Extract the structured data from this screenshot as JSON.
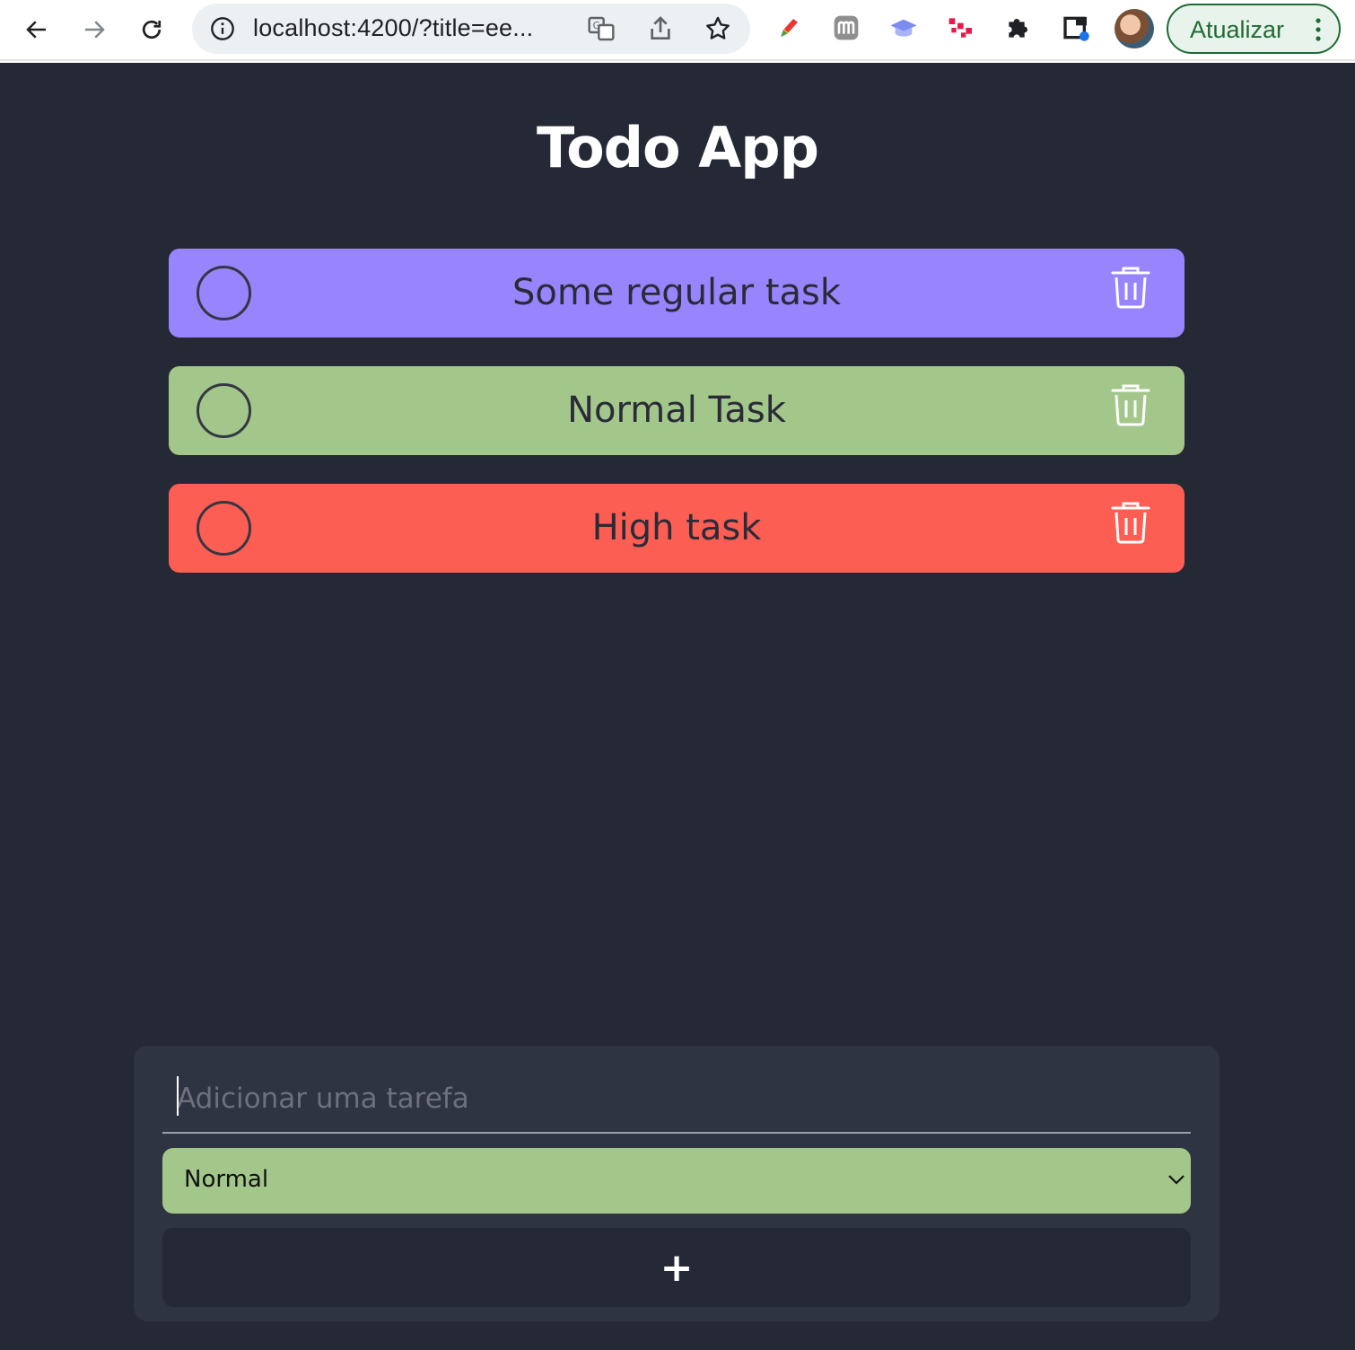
{
  "browser": {
    "url": "localhost:4200/?title=ee...",
    "update_label": "Atualizar",
    "extensions": [
      "pencil-extension-icon",
      "m-extension-icon",
      "graduation-cap-extension-icon",
      "dots-extension-icon",
      "puzzle-extension-icon",
      "media-extension-icon"
    ]
  },
  "app": {
    "title": "Todo App"
  },
  "tasks": [
    {
      "title": "Some regular task",
      "priority": "regular",
      "color": "#9884fd"
    },
    {
      "title": "Normal Task",
      "priority": "normal",
      "color": "#a3c78a"
    },
    {
      "title": "High task",
      "priority": "high",
      "color": "#fd5e53"
    }
  ],
  "form": {
    "placeholder": "Adicionar uma tarefa",
    "input_value": "",
    "priority_selected": "Normal",
    "priority_color": "#a3c78a",
    "add_label": "+"
  },
  "colors": {
    "page_bg": "#252935",
    "card_bg": "#2f3443",
    "accent_update": "#1e6b35"
  }
}
